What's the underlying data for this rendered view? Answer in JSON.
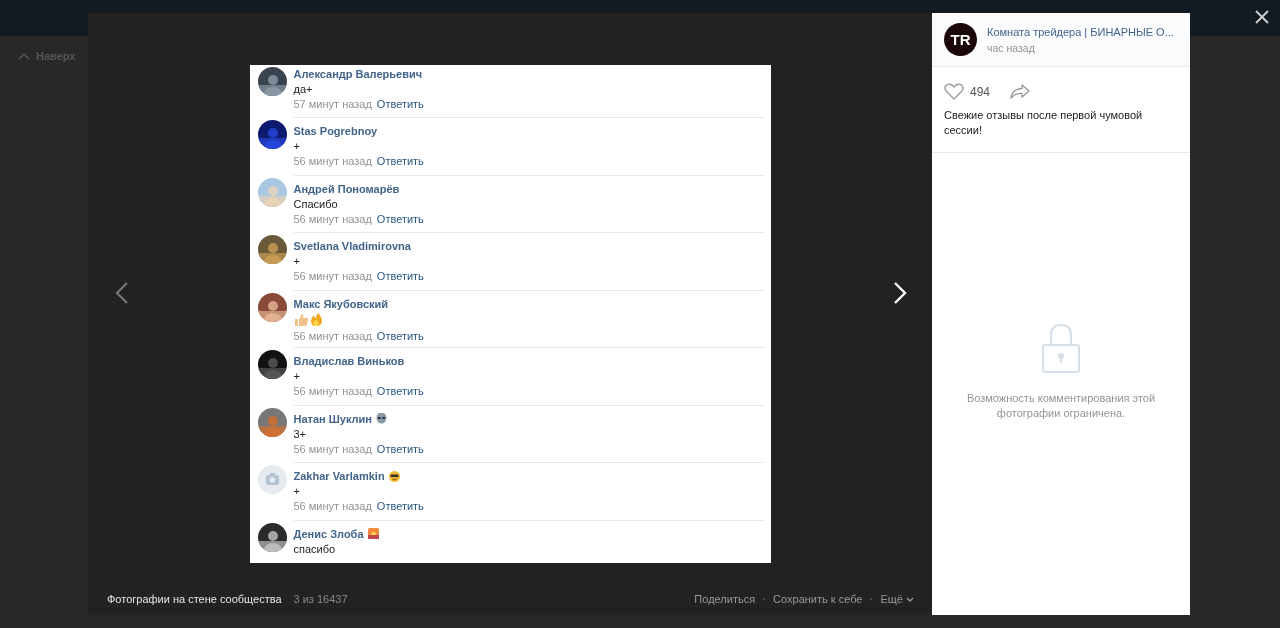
{
  "page": {
    "back_to_top": "Наверх"
  },
  "photo": {
    "comments": [
      {
        "name": "Александр Валерьевич",
        "text": "да+",
        "kind": "text",
        "time": "57 минут назад",
        "reply": "Ответить"
      },
      {
        "name": "Stas Pogrebnoy",
        "text": "+",
        "kind": "text",
        "time": "56 минут назад",
        "reply": "Ответить"
      },
      {
        "name": "Андрей Пономарёв",
        "text": "Спасибо",
        "kind": "text",
        "time": "56 минут назад",
        "reply": "Ответить"
      },
      {
        "name": "Svetlana Vladimirovna",
        "text": "+",
        "kind": "text",
        "time": "56 минут назад",
        "reply": "Ответить"
      },
      {
        "name": "Макс Якубовский",
        "kind": "emoji",
        "time": "56 минут назад",
        "reply": "Ответить"
      },
      {
        "name": "Владислав Виньков",
        "text": "+",
        "kind": "text",
        "time": "56 минут назад",
        "reply": "Ответить"
      },
      {
        "name": "Натан Шуклин",
        "name_icon": {
          "kind": "alien"
        },
        "text": "3+",
        "kind": "text",
        "time": "56 минут назад",
        "reply": "Ответить"
      },
      {
        "name": "Zakhar Varlamkin",
        "name_icon": {
          "kind": "sunglasses"
        },
        "text": "+",
        "kind": "text",
        "avatar": {
          "kind": "placeholder"
        },
        "time": "56 минут назад",
        "reply": "Ответить"
      },
      {
        "name": "Денис Злоба",
        "name_icon": {
          "kind": "sunset"
        },
        "text": "спасибо",
        "kind": "text"
      }
    ]
  },
  "footer": {
    "album": "Фотографии на стене сообщества",
    "counter": "3 из 16437",
    "actions": [
      "Поделиться",
      "Сохранить к себе",
      "Ещё"
    ]
  },
  "post": {
    "logo_text": "TR",
    "author": "Комната трейдера | БИНАРНЫЕ О...",
    "time": "час назад",
    "likes": "494",
    "text": "Свежие отзывы после первой чумовой сессии!",
    "comments_notice": "Возможность комментирования этой фотографии ограничена."
  }
}
